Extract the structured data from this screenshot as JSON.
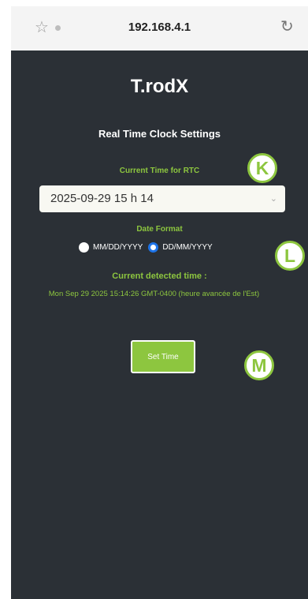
{
  "browser": {
    "url": "192.168.4.1",
    "star_icon": "☆",
    "reload_icon": "↻"
  },
  "page": {
    "title": "T.rodX",
    "heading": "Real Time Clock Settings",
    "rtc_label": "Current Time for RTC",
    "rtc_value": "2025-09-29 15 h 14",
    "select_chevron": "⌄",
    "date_format_label": "Date Format",
    "formats": [
      {
        "label": "MM/DD/YYYY",
        "checked": false
      },
      {
        "label": "DD/MM/YYYY",
        "checked": true
      }
    ],
    "detected_label": "Current detected time :",
    "detected_value": "Mon Sep 29 2025 15:14:26 GMT-0400 (heure avancée de l'Est)",
    "set_button": "Set Time"
  },
  "annotations": {
    "k": "K",
    "l": "L",
    "m": "M"
  },
  "colors": {
    "accent": "#8dc63f",
    "background": "#2b3036",
    "radio_selected": "#1e74e8"
  }
}
